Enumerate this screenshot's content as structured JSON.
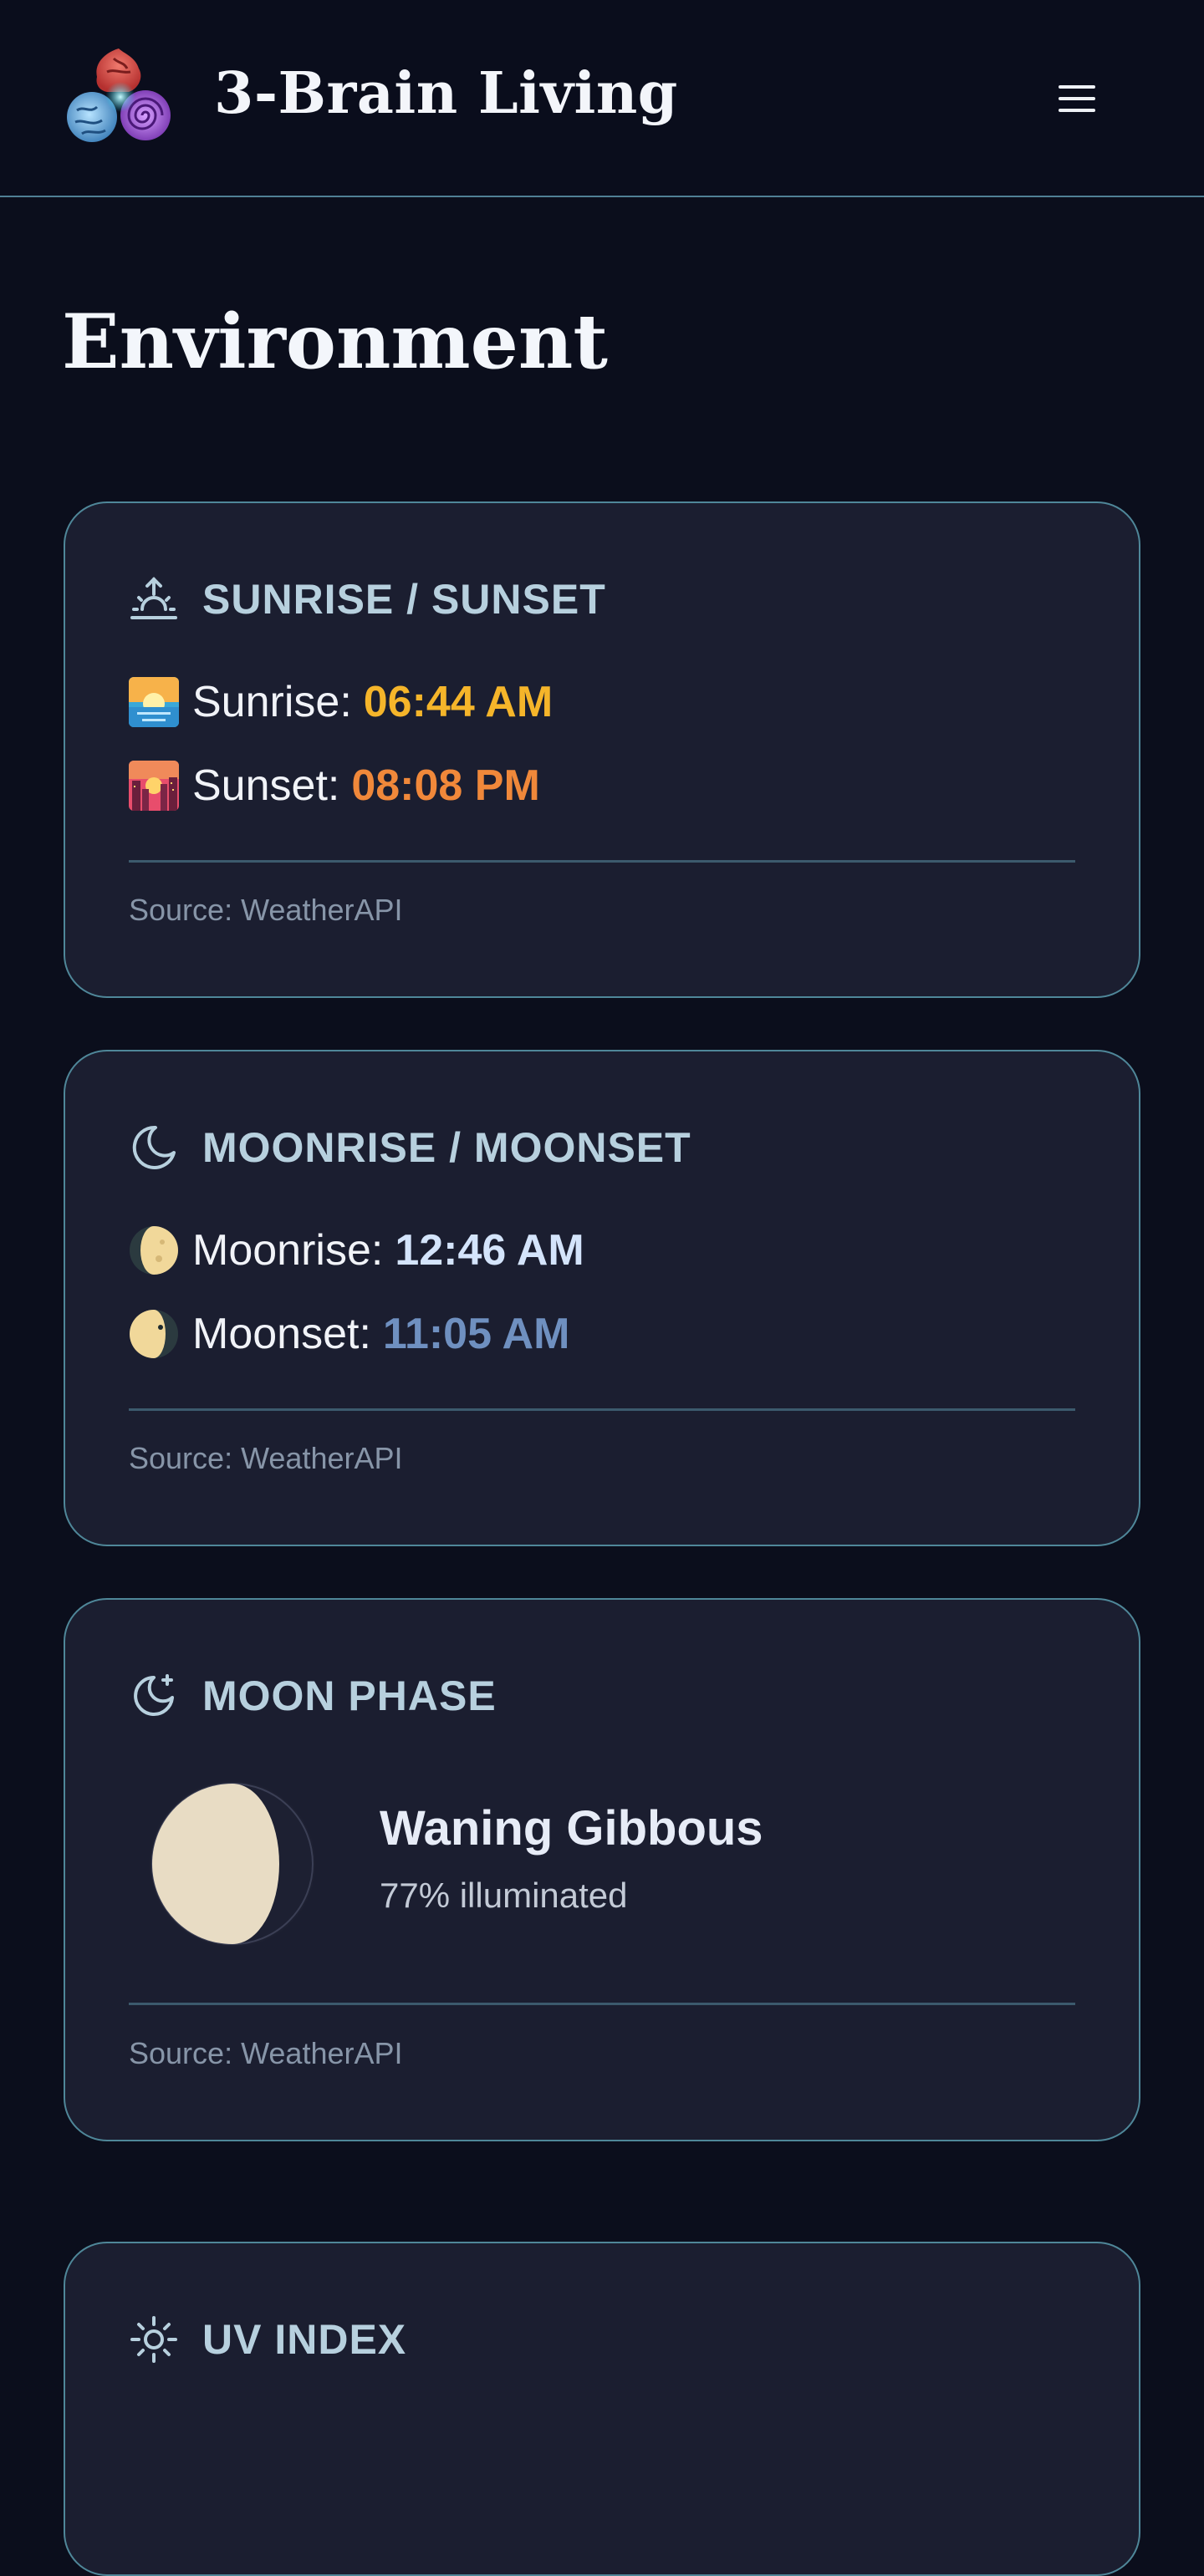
{
  "header": {
    "brand": "3-Brain Living",
    "logo_icon": "three-brains-logo-icon",
    "menu_icon": "hamburger-menu-icon"
  },
  "page": {
    "title": "Environment"
  },
  "sun": {
    "title": "SUNRISE / SUNSET",
    "icon": "sunrise-icon",
    "sunrise_label": "Sunrise:",
    "sunrise_value": "06:44 AM",
    "sunrise_color": "#f5b52a",
    "sunset_label": "Sunset:",
    "sunset_value": "08:08 PM",
    "sunset_color": "#f0883a",
    "source": "Source: WeatherAPI"
  },
  "moon_times": {
    "title": "MOONRISE / MOONSET",
    "icon": "moon-icon",
    "moonrise_label": "Moonrise:",
    "moonrise_value": "12:46 AM",
    "moonrise_color": "#d4e4fb",
    "moonset_label": "Moonset:",
    "moonset_value": "11:05 AM",
    "moonset_color": "#6f90c0",
    "source": "Source: WeatherAPI"
  },
  "moon_phase": {
    "title": "MOON PHASE",
    "icon": "moon-star-icon",
    "phase": "Waning Gibbous",
    "illumination": "77% illuminated",
    "illumination_fraction": 0.77,
    "source": "Source: WeatherAPI"
  },
  "uv": {
    "title": "UV INDEX",
    "icon": "sun-icon"
  }
}
